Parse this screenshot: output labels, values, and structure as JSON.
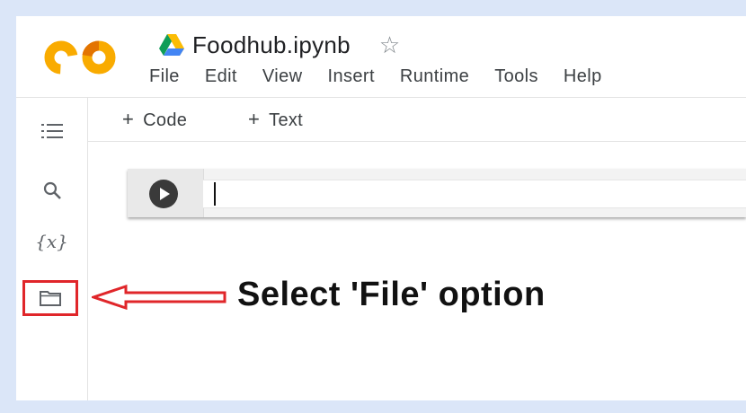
{
  "app": {
    "logo_text": "CO",
    "file_name": "Foodhub.ipynb",
    "drive_icon": "google-drive-icon",
    "star_icon": "star-outline-icon"
  },
  "menu": {
    "items": [
      "File",
      "Edit",
      "View",
      "Insert",
      "Runtime",
      "Tools",
      "Help"
    ]
  },
  "toolbar": {
    "add_code_plus": "+",
    "add_code_label": "Code",
    "add_text_plus": "+",
    "add_text_label": "Text"
  },
  "sidebar": {
    "icons": [
      "table-of-contents-icon",
      "search-icon",
      "variables-icon",
      "files-folder-icon"
    ],
    "variables_glyph": "{x}"
  },
  "cell": {
    "run_icon": "play-circle-icon",
    "content": ""
  },
  "annotation": {
    "text": "Select 'File' option",
    "highlight_color": "#e0262a",
    "arrow_color": "#e0262a"
  },
  "colors": {
    "logo_orange": "#f9ab00",
    "logo_orange_dark": "#e37400",
    "frame_border": "#dbe6f8"
  }
}
